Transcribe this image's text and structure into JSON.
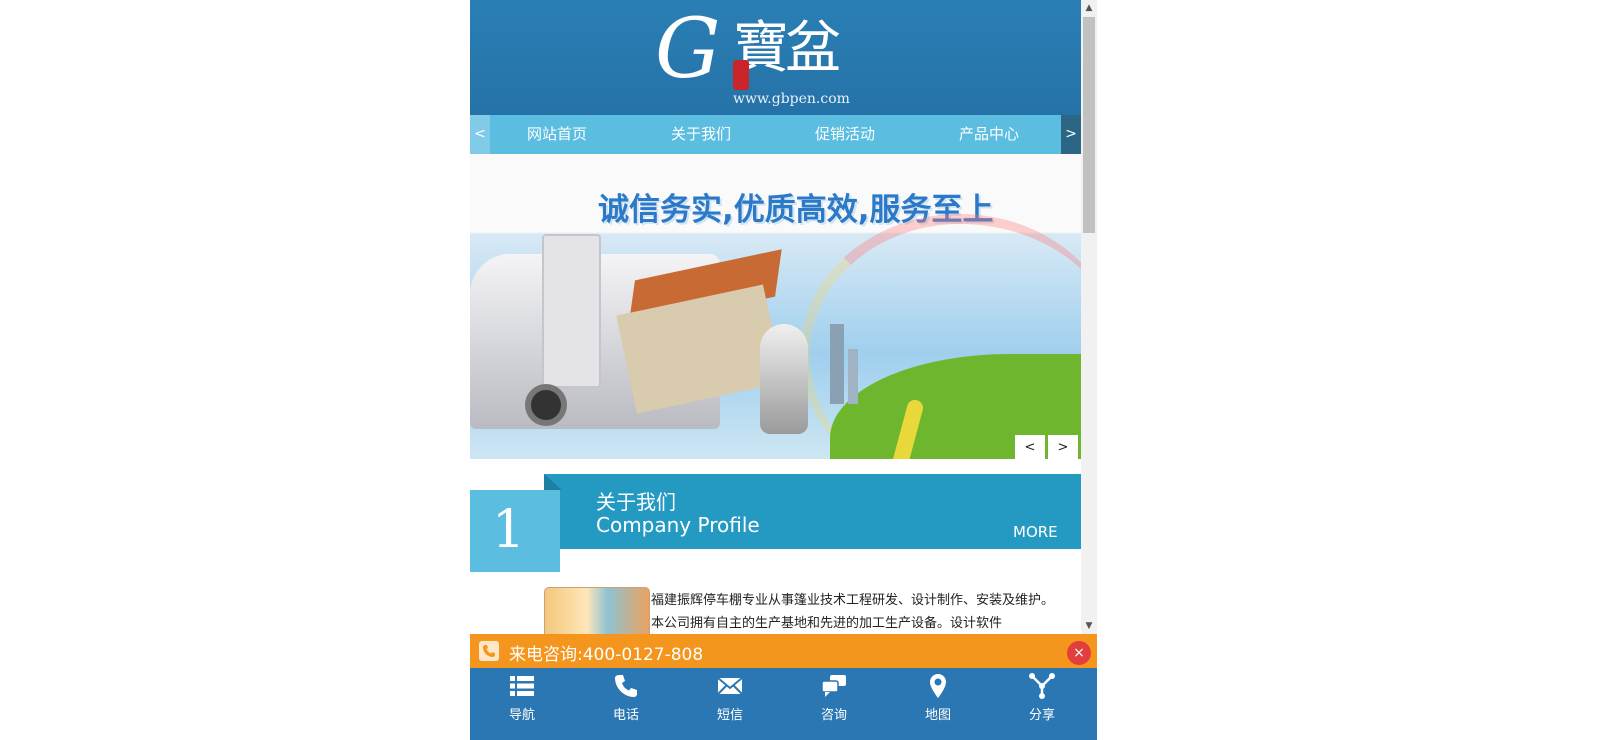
{
  "header": {
    "logo_letter": "G",
    "logo_chinese": "寶盆",
    "logo_url": "www.gbpen.com"
  },
  "nav": {
    "prev": "<",
    "next": ">",
    "items": [
      "网站首页",
      "关于我们",
      "促销活动",
      "产品中心"
    ]
  },
  "banner": {
    "slogan": "诚信务实,优质高效,服务至上",
    "prev": "<",
    "next": ">"
  },
  "about": {
    "number": "1",
    "title": "关于我们",
    "subtitle": "Company Profile",
    "more": "MORE",
    "text": "福建振辉停车棚专业从事篷业技术工程研发、设计制作、安装及维护。 本公司拥有自主的生产基地和先进的加工生产设备。设计软件"
  },
  "scrollbar": {
    "up": "▲",
    "down": "▼"
  },
  "phone_bar": {
    "label": "来电咨询:",
    "number": "400-0127-808",
    "close": "×"
  },
  "bottom_bar": {
    "items": [
      {
        "label": "导航",
        "icon": "list-icon"
      },
      {
        "label": "电话",
        "icon": "phone-icon"
      },
      {
        "label": "短信",
        "icon": "envelope-icon"
      },
      {
        "label": "咨询",
        "icon": "chat-icon"
      },
      {
        "label": "地图",
        "icon": "map-pin-icon"
      },
      {
        "label": "分享",
        "icon": "share-icon"
      }
    ]
  },
  "colors": {
    "header_blue": "#2572a8",
    "nav_blue": "#5bbde0",
    "section_blue": "#249ac2",
    "orange": "#f4961e",
    "bottom_blue": "#2b77b3",
    "close_red": "#e23e3e"
  }
}
